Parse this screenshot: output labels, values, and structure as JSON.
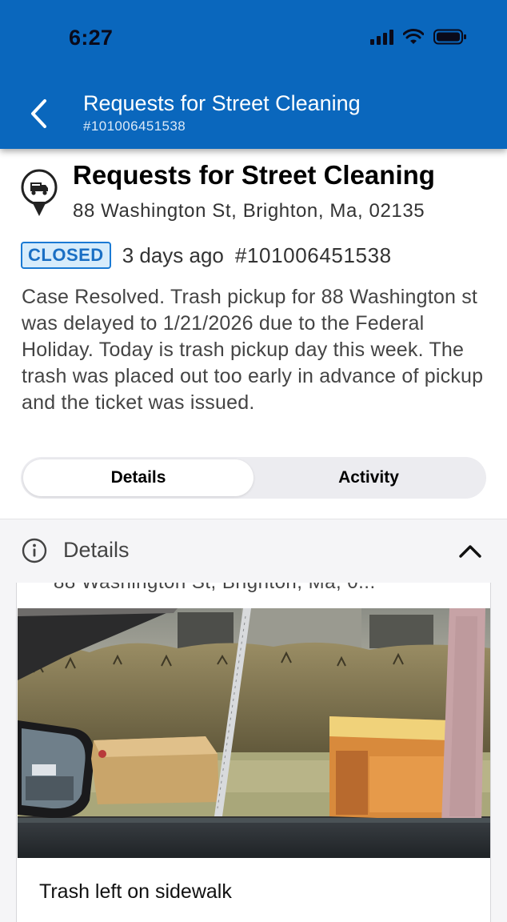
{
  "status_bar": {
    "time": "6:27"
  },
  "header": {
    "title": "Requests for Street Cleaning",
    "case_number": "#101006451538"
  },
  "request": {
    "service_name": "Requests for Street Cleaning",
    "address": "88 Washington St, Brighton, Ma, 02135",
    "status": "CLOSED",
    "age": "3 days ago",
    "case_number": "#101006451538",
    "description": "Case Resolved. Trash pickup for 88 Washington st was delayed to 1/21/2026 due to the Federal Holiday. Today is trash pickup day this week. The trash was placed out too early in advance of pickup and the ticket was issued."
  },
  "tabs": [
    {
      "label": "Details",
      "active": true
    },
    {
      "label": "Activity",
      "active": false
    }
  ],
  "details_section": {
    "title": "Details",
    "partial_address": "88 Washington St, Brighton, Ma, 0...",
    "photo_caption": "Trash left on sidewalk"
  },
  "colors": {
    "header_blue": "#0a67bd",
    "badge_blue": "#1a7ad4",
    "badge_bg": "#d7ecfb"
  },
  "icons": [
    "back-chevron-icon",
    "truck-pin-icon",
    "info-icon",
    "chevron-up-icon",
    "signal-icon",
    "wifi-icon",
    "battery-icon"
  ]
}
